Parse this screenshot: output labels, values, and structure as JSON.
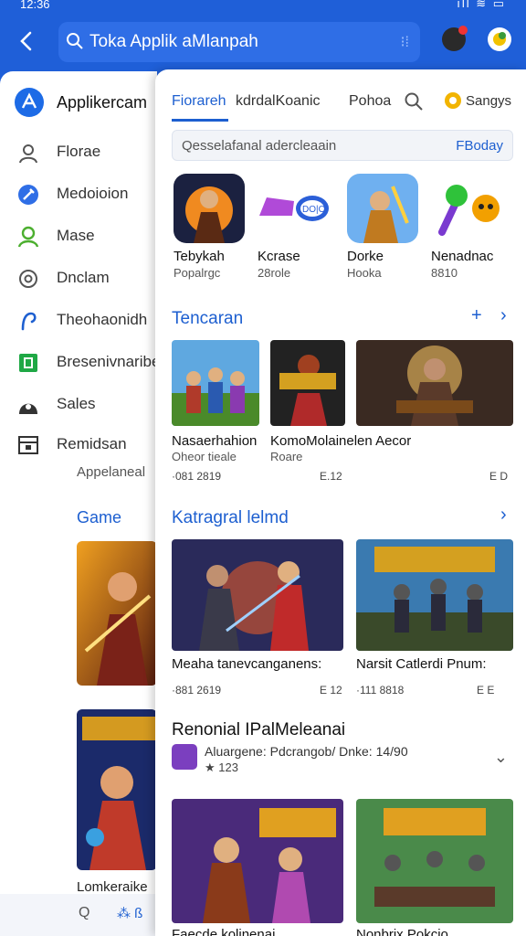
{
  "status": {
    "time": "12:36",
    "signal": "ıll ≋ ▭"
  },
  "topbar": {
    "search_text": "Toka Applik aMlanpah",
    "mic_glyph": "⁝⁞"
  },
  "drawer": {
    "brand": "Applikercam",
    "items": [
      {
        "label": "Florae",
        "icon": "user-badge-icon"
      },
      {
        "label": "Medoioion",
        "icon": "tools-icon"
      },
      {
        "label": "Mase",
        "icon": "person-icon"
      },
      {
        "label": "Dnclam",
        "icon": "settings-icon"
      },
      {
        "label": "Theohaonidh",
        "icon": "hook-icon"
      },
      {
        "label": "Bresenivnaribe",
        "icon": "frame-icon"
      },
      {
        "label": "Sales",
        "icon": "sales-icon"
      },
      {
        "label": "Remidsan",
        "icon": "calendar-icon"
      }
    ],
    "sub_label": "Appelaneal",
    "game_heading": "Game",
    "footer_label": "Lomkeraike",
    "bottom_left": "Q",
    "bottom_right": "⁂ ß"
  },
  "tabs": {
    "items": [
      "Fiorareh",
      "kdrdalKoanic",
      "Pohoa"
    ],
    "settings_label": "Sangys"
  },
  "subsearch": {
    "placeholder": "Qesselafanal adercleaain",
    "action": "FBoday"
  },
  "apps": [
    {
      "title": "Tebykah",
      "sub": "Popalrgc"
    },
    {
      "title": "Kcrase",
      "sub": "28role"
    },
    {
      "title": "Dorke",
      "sub": "Hooka"
    },
    {
      "title": "Nenadnac",
      "sub": "8810"
    }
  ],
  "sections": {
    "recommended": "Tencaran",
    "category": "Katragral lelmd",
    "featured": "Renonial IPalMeleanai"
  },
  "recommended_cards": [
    {
      "label": "Nasaerhahion",
      "sub": "Oheor tieale",
      "meta": "·081 2819"
    },
    {
      "label": "KomoMolainelen Aecor",
      "sub": "Roare",
      "meta": "E.12"
    },
    {
      "label": "",
      "sub": "",
      "meta": "E D"
    }
  ],
  "category_cards": [
    {
      "label": "Meaha tanevcanganens:",
      "meta": "·881 2619",
      "meta2": "E 12"
    },
    {
      "label": "Narsit Catlerdi Pnum:",
      "meta": "·111 8818",
      "meta2": "E E"
    }
  ],
  "featured_row": {
    "desc": "Aluargene: Pdcrangob/ Dnke: 14/90",
    "rating": "★ 123"
  },
  "bottom_cards": [
    {
      "label": "Faecde kolinenai"
    },
    {
      "label": "Nonbrix Pokcio"
    }
  ]
}
